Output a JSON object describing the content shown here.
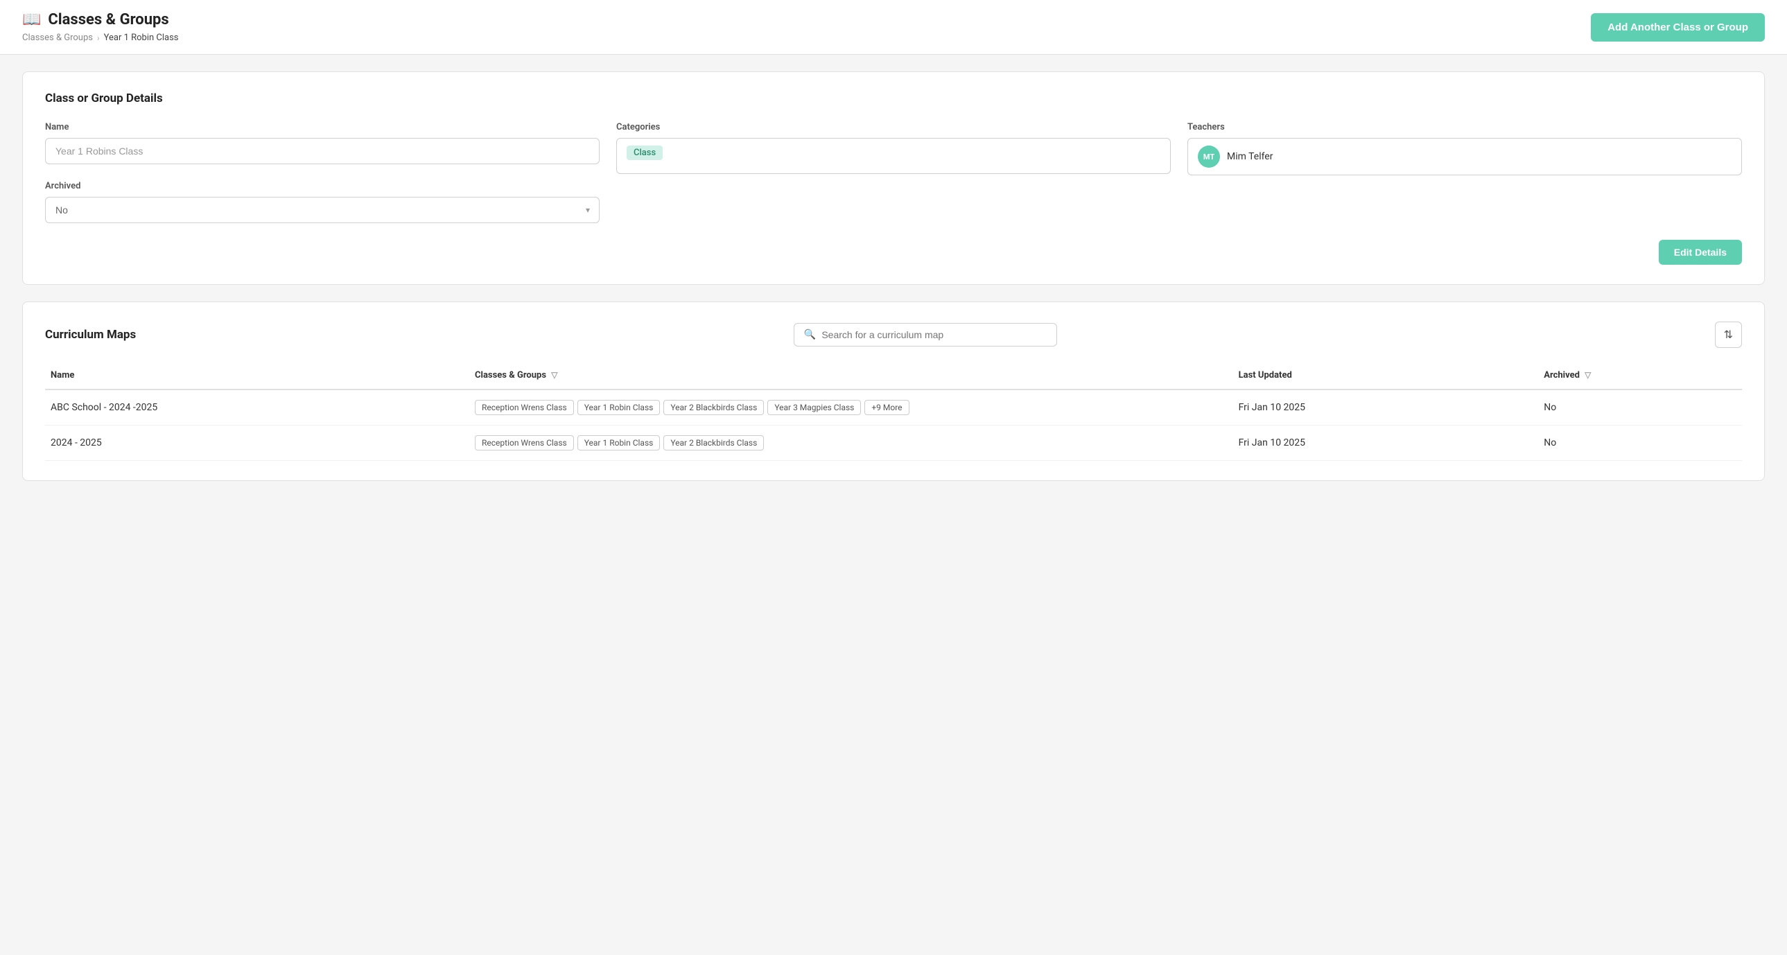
{
  "page": {
    "title": "Classes & Groups",
    "title_icon": "📖",
    "breadcrumb": {
      "parent": "Classes & Groups",
      "current": "Year 1 Robin Class"
    },
    "add_button_label": "Add Another Class or Group"
  },
  "details_card": {
    "title": "Class or Group Details",
    "name_label": "Name",
    "name_value": "Year 1 Robins Class",
    "name_placeholder": "Year 1 Robins Class",
    "categories_label": "Categories",
    "category_tag": "Class",
    "teachers_label": "Teachers",
    "teacher_name": "Mim Telfer",
    "teacher_initials": "MT",
    "archived_label": "Archived",
    "archived_value": "No",
    "edit_button_label": "Edit Details"
  },
  "curriculum_maps": {
    "title": "Curriculum Maps",
    "search_placeholder": "Search for a curriculum map",
    "columns": {
      "name": "Name",
      "groups": "Classes & Groups",
      "last_updated": "Last Updated",
      "archived": "Archived"
    },
    "rows": [
      {
        "name": "ABC School - 2024 -2025",
        "groups": [
          "Reception Wrens Class",
          "Year 1 Robin Class",
          "Year 2 Blackbirds Class",
          "Year 3 Magpies Class",
          "+9 More"
        ],
        "last_updated": "Fri Jan 10 2025",
        "archived": "No"
      },
      {
        "name": "2024 - 2025",
        "groups": [
          "Reception Wrens Class",
          "Year 1 Robin Class",
          "Year 2 Blackbirds Class"
        ],
        "last_updated": "Fri Jan 10 2025",
        "archived": "No"
      }
    ]
  }
}
